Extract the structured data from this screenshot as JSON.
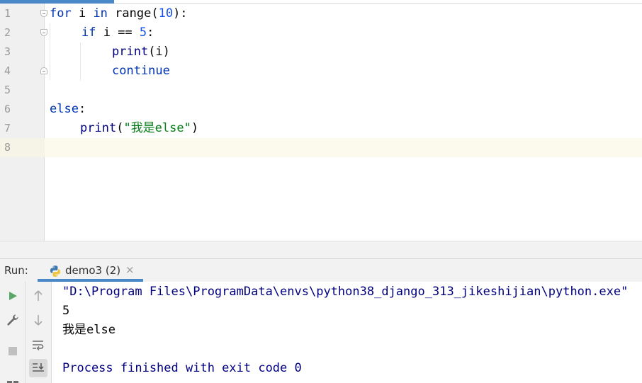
{
  "editor": {
    "line_numbers": [
      "1",
      "2",
      "3",
      "4",
      "5",
      "6",
      "7",
      "8"
    ],
    "lines": {
      "l1": {
        "kw_for": "for",
        "var": " i ",
        "kw_in": "in",
        "range": " range(",
        "num": "10",
        "close": "):"
      },
      "l2": {
        "kw_if": "if",
        "cond": " i == ",
        "num": "5",
        "colon": ":"
      },
      "l3": {
        "call": "print",
        "args": "(i)"
      },
      "l4": {
        "kw": "continue"
      },
      "l6": {
        "kw": "else",
        "colon": ":"
      },
      "l7": {
        "call": "print",
        "open": "(",
        "str": "\"我是else\"",
        "close": ")"
      }
    },
    "current_line": 8
  },
  "run": {
    "label": "Run:",
    "tab_label": "demo3 (2)",
    "tab_close": "×",
    "console": [
      "\"D:\\Program Files\\ProgramData\\envs\\python38_django_313_jikeshijian\\python.exe\"",
      "5",
      "我是else",
      "",
      "Process finished with exit code 0"
    ]
  },
  "icons": {
    "run": "run-icon",
    "wrench": "wrench-icon",
    "stop": "stop-icon",
    "up": "arrow-up-icon",
    "down": "arrow-down-icon",
    "wrap": "soft-wrap-icon",
    "scroll_end": "scroll-to-end-icon",
    "python": "python-icon"
  },
  "colors": {
    "accent": "#4a88c7",
    "keyword": "#0033b3",
    "number": "#1750eb",
    "string": "#067d17",
    "current_line": "#fcfaed",
    "run_green": "#59a869"
  }
}
